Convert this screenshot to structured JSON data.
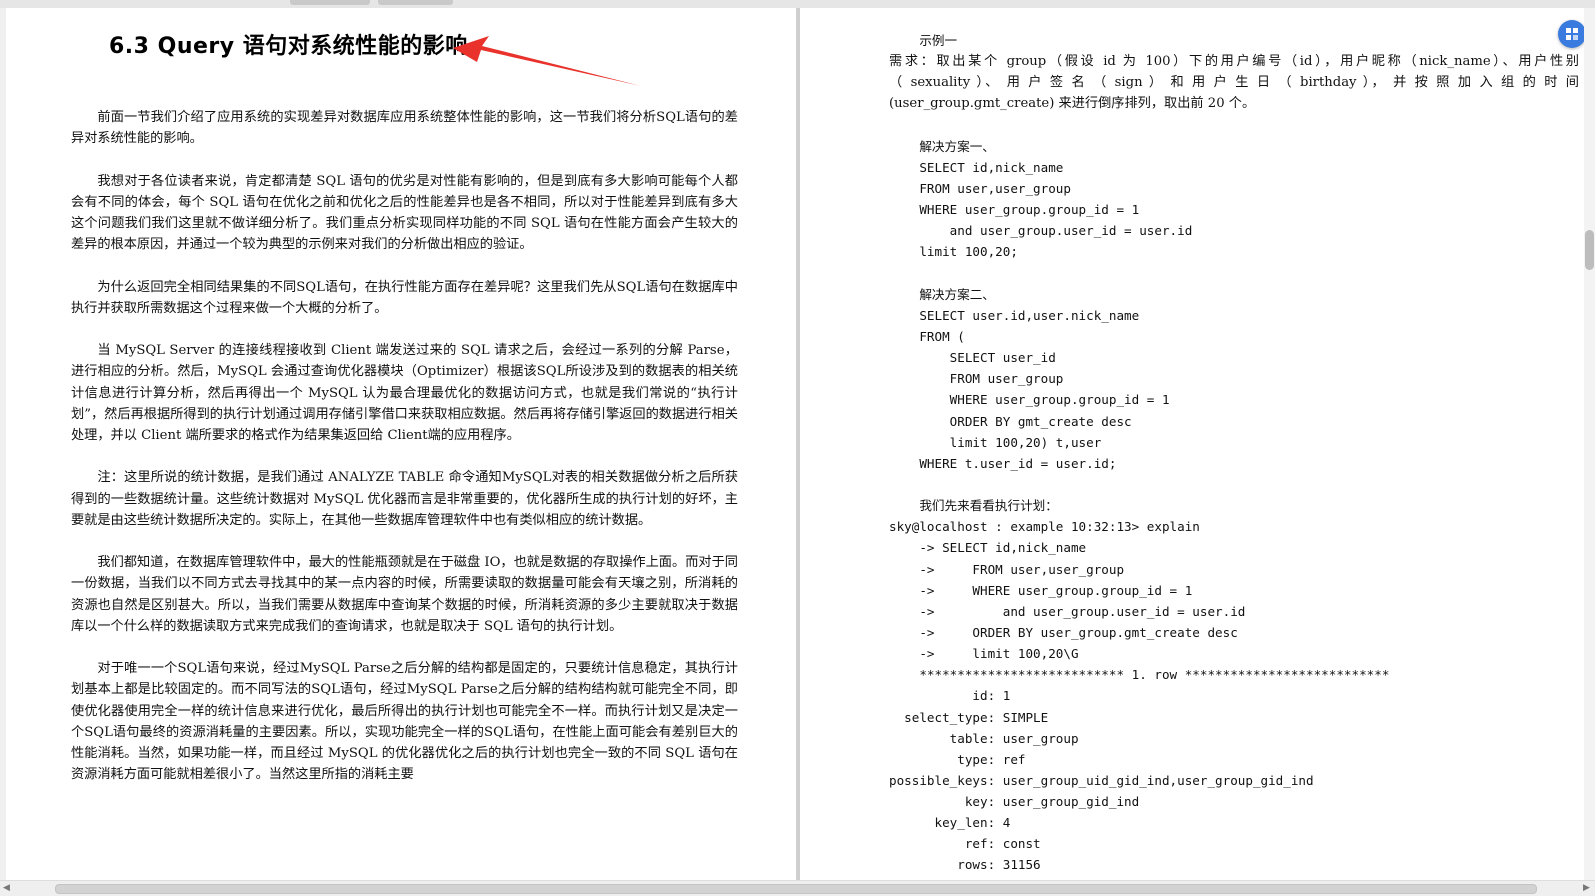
{
  "left_page": {
    "heading": "6.3 Query 语句对系统性能的影响",
    "paragraphs": [
      "前面一节我们介绍了应用系统的实现差异对数据库应用系统整体性能的影响，这一节我们将分析SQL语句的差异对系统性能的影响。",
      "我想对于各位读者来说，肯定都清楚 SQL 语句的优劣是对性能有影响的，但是到底有多大影响可能每个人都会有不同的体会，每个 SQL 语句在优化之前和优化之后的性能差异也是各不相同，所以对于性能差异到底有多大这个问题我们我们这里就不做详细分析了。我们重点分析实现同样功能的不同 SQL 语句在性能方面会产生较大的差异的根本原因，并通过一个较为典型的示例来对我们的分析做出相应的验证。",
      "为什么返回完全相同结果集的不同SQL语句，在执行性能方面存在差异呢？这里我们先从SQL语句在数据库中执行并获取所需数据这个过程来做一个大概的分析了。",
      "当 MySQL Server 的连接线程接收到 Client 端发送过来的 SQL 请求之后，会经过一系列的分解 Parse，进行相应的分析。然后，MySQL 会通过查询优化器模块（Optimizer）根据该SQL所设涉及到的数据表的相关统计信息进行计算分析，然后再得出一个 MySQL 认为最合理最优化的数据访问方式，也就是我们常说的“执行计划”，然后再根据所得到的执行计划通过调用存储引擎借口来获取相应数据。然后再将存储引擎返回的数据进行相关处理，并以 Client 端所要求的格式作为结果集返回给 Client端的应用程序。",
      "注：这里所说的统计数据，是我们通过 ANALYZE TABLE 命令通知MySQL对表的相关数据做分析之后所获得到的一些数据统计量。这些统计数据对 MySQL 优化器而言是非常重要的，优化器所生成的执行计划的好坏，主要就是由这些统计数据所决定的。实际上，在其他一些数据库管理软件中也有类似相应的统计数据。",
      "我们都知道，在数据库管理软件中，最大的性能瓶颈就是在于磁盘 IO，也就是数据的存取操作上面。而对于同一份数据，当我们以不同方式去寻找其中的某一点内容的时候，所需要读取的数据量可能会有天壤之别，所消耗的资源也自然是区别甚大。所以，当我们需要从数据库中查询某个数据的时候，所消耗资源的多少主要就取决于数据库以一个什么样的数据读取方式来完成我们的查询请求，也就是取决于 SQL 语句的执行计划。",
      "对于唯一一个SQL语句来说，经过MySQL Parse之后分解的结构都是固定的，只要统计信息稳定，其执行计划基本上都是比较固定的。而不同写法的SQL语句，经过MySQL Parse之后分解的结构结构就可能完全不同，即使优化器使用完全一样的统计信息来进行优化，最后所得出的执行计划也可能完全不一样。而执行计划又是决定一个SQL语句最终的资源消耗量的主要因素。所以，实现功能完全一样的SQL语句，在性能上面可能会有差别巨大的性能消耗。当然，如果功能一样，而且经过 MySQL 的优化器优化之后的执行计划也完全一致的不同 SQL 语句在资源消耗方面可能就相差很小了。当然这里所指的消耗主要"
    ]
  },
  "right_page": {
    "lines": [
      "    示例一",
      "    需求：取出某个 group（假设 id 为 100）下的用户编号（id），用户昵称（nick_name）、用户性别",
      "（ sexuality ）、 用 户 签 名 （ sign ） 和 用 户 生 日 （ birthday ）， 并 按 照 加 入 组 的 时 间",
      "(user_group.gmt_create) 来进行倒序排列，取出前 20 个。",
      "",
      "    解决方案一、",
      "    SELECT id,nick_name",
      "    FROM user,user_group",
      "    WHERE user_group.group_id = 1",
      "        and user_group.user_id = user.id",
      "    limit 100,20;",
      "",
      "    解决方案二、",
      "    SELECT user.id,user.nick_name",
      "    FROM (",
      "        SELECT user_id",
      "        FROM user_group",
      "        WHERE user_group.group_id = 1",
      "        ORDER BY gmt_create desc",
      "        limit 100,20) t,user",
      "    WHERE t.user_id = user.id;",
      "",
      "    我们先来看看执行计划：",
      "sky@localhost : example 10:32:13> explain",
      "    -> SELECT id,nick_name",
      "    ->     FROM user,user_group",
      "    ->     WHERE user_group.group_id = 1",
      "    ->         and user_group.user_id = user.id",
      "    ->     ORDER BY user_group.gmt_create desc",
      "    ->     limit 100,20\\G",
      "    *************************** 1. row ***************************",
      "           id: 1",
      "  select_type: SIMPLE",
      "        table: user_group",
      "         type: ref",
      "possible_keys: user_group_uid_gid_ind,user_group_gid_ind",
      "          key: user_group_gid_ind",
      "      key_len: 4",
      "          ref: const",
      "         rows: 31156"
    ]
  },
  "colors": {
    "arrow": "#e8322b",
    "float_button": "#3a7be0"
  },
  "icons": {
    "float_button": "grid-icon"
  }
}
